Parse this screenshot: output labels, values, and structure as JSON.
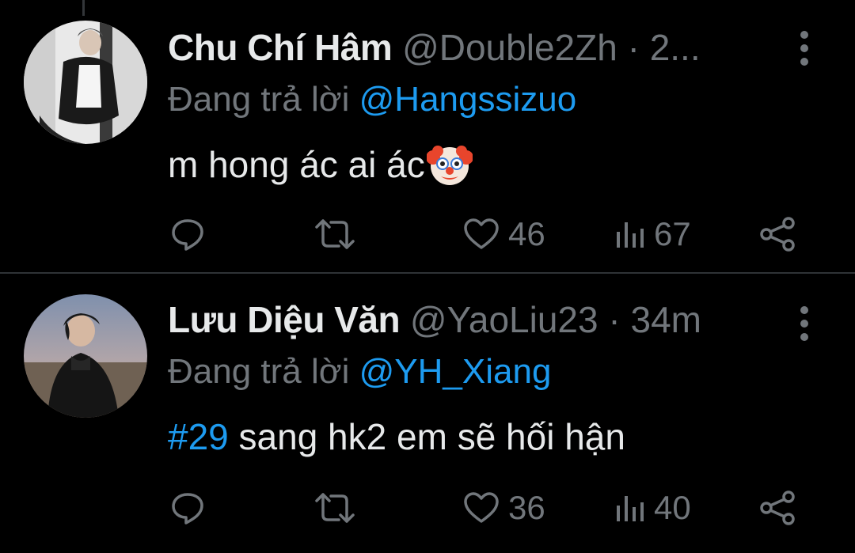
{
  "colors": {
    "background": "#000000",
    "primary_text": "#e7e9ea",
    "secondary_text": "#71767b",
    "accent": "#1d9bf0",
    "divider": "#2f3336"
  },
  "tweets": [
    {
      "display_name": "Chu Chí Hâm",
      "handle": "@Double2Zh",
      "separator": "·",
      "time": "2...",
      "reply_prefix": "Đang trả lời",
      "reply_to": "@Hangssizuo",
      "hashtag": "",
      "text": "m hong ác ai ác",
      "emoji_icon": "clown-face-icon",
      "replies": "",
      "retweets": "",
      "likes": "46",
      "views": "67"
    },
    {
      "display_name": "Lưu Diệu Văn",
      "handle": "@YaoLiu23",
      "separator": "·",
      "time": "34m",
      "reply_prefix": "Đang trả lời",
      "reply_to": "@YH_Xiang",
      "hashtag": "#29",
      "text": " sang hk2 em sẽ hối hận",
      "emoji_icon": "",
      "replies": "",
      "retweets": "",
      "likes": "36",
      "views": "40"
    }
  ]
}
